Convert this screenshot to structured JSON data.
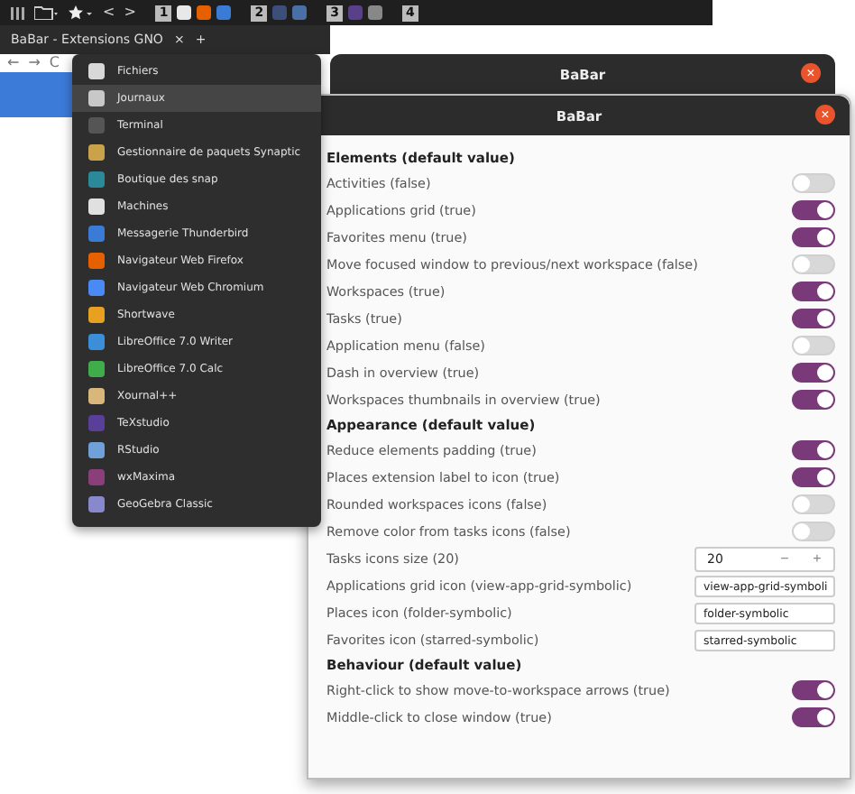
{
  "top_bar": {
    "arrows": [
      "<",
      ">"
    ],
    "workspaces": [
      {
        "label": "1",
        "apps": [
          {
            "kind": "files"
          },
          {
            "kind": "firefox"
          },
          {
            "kind": "thunderbird"
          }
        ]
      },
      {
        "label": "2",
        "apps": [
          {
            "kind": "dim"
          },
          {
            "kind": "chromium"
          }
        ]
      },
      {
        "label": "3",
        "apps": [
          {
            "kind": "texstudio"
          },
          {
            "kind": "image"
          }
        ]
      },
      {
        "label": "4"
      }
    ]
  },
  "browser": {
    "tab_title": "BaBar - Extensions GNO",
    "tab_close": "×",
    "new_tab": "+",
    "nav": [
      "←",
      "→",
      "C"
    ]
  },
  "menu": {
    "items": [
      {
        "label": "Fichiers",
        "color": "#d8d8d8",
        "selected": false
      },
      {
        "label": "Journaux",
        "color": "#c8c8c8",
        "selected": true
      },
      {
        "label": "Terminal",
        "color": "#555555",
        "selected": false
      },
      {
        "label": "Gestionnaire de paquets Synaptic",
        "color": "#c9a24a",
        "selected": false
      },
      {
        "label": "Boutique des snap",
        "color": "#2a8a9a",
        "selected": false
      },
      {
        "label": "Machines",
        "color": "#e0e0e0",
        "selected": false
      },
      {
        "label": "Messagerie Thunderbird",
        "color": "#3a7bd5",
        "selected": false
      },
      {
        "label": "Navigateur Web Firefox",
        "color": "#e66000",
        "selected": false
      },
      {
        "label": "Navigateur Web Chromium",
        "color": "#4a8af4",
        "selected": false
      },
      {
        "label": "Shortwave",
        "color": "#e8a020",
        "selected": false
      },
      {
        "label": "LibreOffice 7.0 Writer",
        "color": "#3a8fd8",
        "selected": false
      },
      {
        "label": "LibreOffice 7.0 Calc",
        "color": "#3fae4a",
        "selected": false
      },
      {
        "label": "Xournal++",
        "color": "#d9b67a",
        "selected": false
      },
      {
        "label": "TeXstudio",
        "color": "#5a3f9a",
        "selected": false
      },
      {
        "label": "RStudio",
        "color": "#6fa0d8",
        "selected": false
      },
      {
        "label": "wxMaxima",
        "color": "#8a3f7a",
        "selected": false
      },
      {
        "label": "GeoGebra Classic",
        "color": "#8888cc",
        "selected": false
      }
    ]
  },
  "back_window": {
    "title": "BaBar",
    "close": "×"
  },
  "window": {
    "title": "BaBar",
    "close": "×",
    "sections": [
      {
        "title": "Elements (default value)",
        "rows": [
          {
            "kind": "toggle",
            "label": "Activities (false)",
            "on": false
          },
          {
            "kind": "toggle",
            "label": "Applications grid (true)",
            "on": true
          },
          {
            "kind": "toggle",
            "label": "Favorites menu (true)",
            "on": true
          },
          {
            "kind": "toggle",
            "label": "Move focused window to previous/next workspace (false)",
            "on": false
          },
          {
            "kind": "toggle",
            "label": "Workspaces (true)",
            "on": true
          },
          {
            "kind": "toggle",
            "label": "Tasks (true)",
            "on": true
          },
          {
            "kind": "toggle",
            "label": "Application menu (false)",
            "on": false
          },
          {
            "kind": "toggle",
            "label": "Dash in overview (true)",
            "on": true
          },
          {
            "kind": "toggle",
            "label": "Workspaces thumbnails in overview (true)",
            "on": true
          }
        ]
      },
      {
        "title": "Appearance (default value)",
        "rows": [
          {
            "kind": "toggle",
            "label": "Reduce elements padding (true)",
            "on": true
          },
          {
            "kind": "toggle",
            "label": "Places extension label to icon (true)",
            "on": true
          },
          {
            "kind": "toggle",
            "label": "Rounded workspaces icons (false)",
            "on": false
          },
          {
            "kind": "toggle",
            "label": "Remove color from tasks icons (false)",
            "on": false
          },
          {
            "kind": "spin",
            "label": "Tasks icons size (20)",
            "value": "20",
            "minus": "−",
            "plus": "+"
          },
          {
            "kind": "text",
            "label": "Applications grid icon (view-app-grid-symbolic)",
            "value": "view-app-grid-symboli"
          },
          {
            "kind": "text",
            "label": "Places icon (folder-symbolic)",
            "value": "folder-symbolic"
          },
          {
            "kind": "text",
            "label": "Favorites icon (starred-symbolic)",
            "value": "starred-symbolic"
          }
        ]
      },
      {
        "title": "Behaviour (default value)",
        "rows": [
          {
            "kind": "toggle",
            "label": "Right-click to show move-to-workspace arrows (true)",
            "on": true
          },
          {
            "kind": "toggle",
            "label": "Middle-click to close window (true)",
            "on": true
          }
        ]
      }
    ]
  }
}
